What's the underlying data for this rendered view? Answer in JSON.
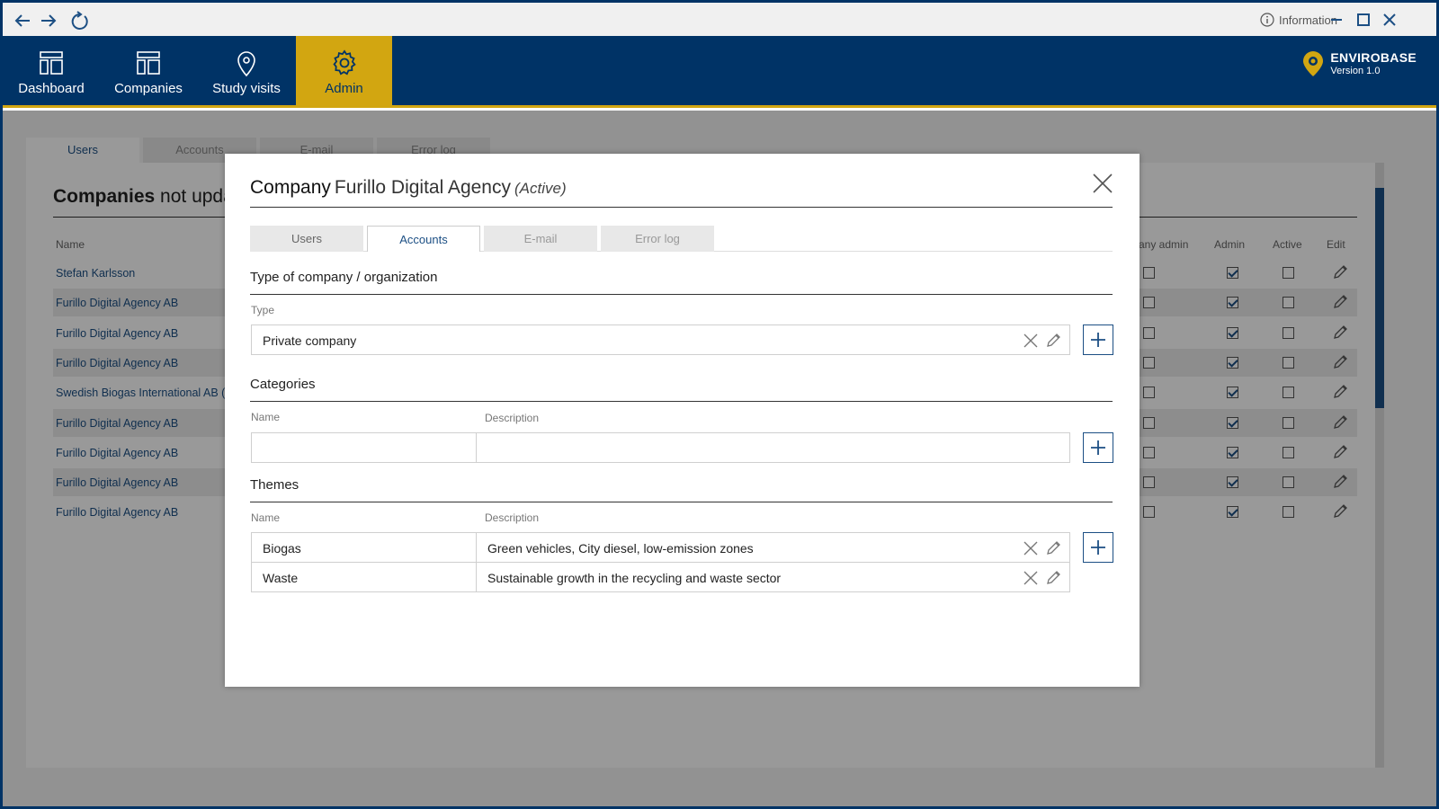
{
  "titlebar": {
    "info_label": "Information"
  },
  "nav": {
    "items": [
      {
        "label": "Dashboard"
      },
      {
        "label": "Companies"
      },
      {
        "label": "Study visits"
      },
      {
        "label": "Admin"
      }
    ]
  },
  "brand": {
    "name": "ENVIROBASE",
    "version": "Version 1.0"
  },
  "background": {
    "tabs": [
      "Users",
      "Accounts",
      "E-mail",
      "Error log"
    ],
    "title_bold": "Companies",
    "title_rest": " not updat",
    "columns": {
      "name": "Name",
      "company_admin": "any admin",
      "admin": "Admin",
      "active": "Active",
      "edit": "Edit"
    },
    "rows": [
      {
        "name": "Stefan Karlsson",
        "admin": true,
        "active": false
      },
      {
        "name": "Furillo Digital Agency AB",
        "admin": true,
        "active": false
      },
      {
        "name": "Furillo Digital Agency AB",
        "admin": true,
        "active": false
      },
      {
        "name": "Furillo Digital Agency AB",
        "admin": true,
        "active": false
      },
      {
        "name": "Swedish Biogas International AB (S",
        "admin": true,
        "active": false
      },
      {
        "name": "Furillo Digital Agency AB",
        "admin": true,
        "active": false
      },
      {
        "name": "Furillo Digital Agency AB",
        "admin": true,
        "active": false
      },
      {
        "name": "Furillo Digital Agency AB",
        "admin": true,
        "active": false
      },
      {
        "name": "Furillo Digital Agency AB",
        "admin": true,
        "active": false
      }
    ]
  },
  "modal": {
    "title_label": "Company",
    "company_name": "Furillo Digital Agency",
    "status": "(Active)",
    "tabs": [
      "Users",
      "Accounts",
      "E-mail",
      "Error log"
    ],
    "active_tab": "Accounts",
    "type_section": {
      "heading": "Type of company / organization",
      "field_label": "Type",
      "value": "Private company"
    },
    "categories": {
      "heading": "Categories",
      "name_label": "Name",
      "description_label": "Description",
      "name_value": "",
      "description_value": ""
    },
    "themes": {
      "heading": "Themes",
      "name_label": "Name",
      "description_label": "Description",
      "rows": [
        {
          "name": "Biogas",
          "description": "Green vehicles, City diesel, low-emission zones"
        },
        {
          "name": "Waste",
          "description": "Sustainable growth in the recycling and waste sector"
        }
      ]
    }
  },
  "colors": {
    "navy": "#003366",
    "gold": "#d2a611",
    "link": "#1c4f84"
  }
}
